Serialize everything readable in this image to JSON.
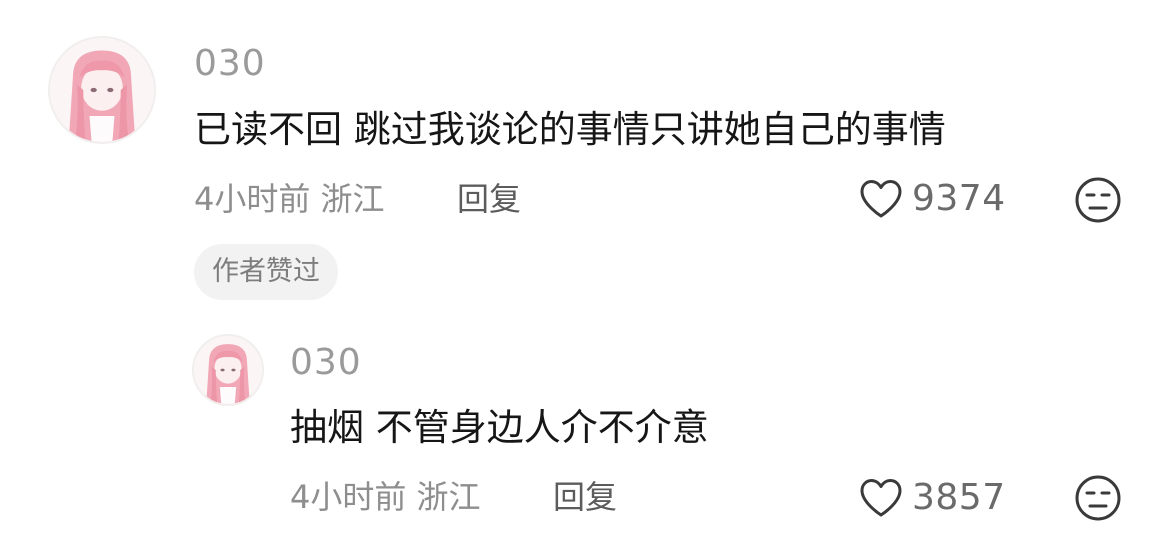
{
  "comments": [
    {
      "username": "030",
      "text": "已读不回 跳过我谈论的事情只讲她自己的事情",
      "meta": "4小时前 浙江",
      "reply_label": "回复",
      "like_count": "9374",
      "badge": "作者赞过",
      "avatar_icon": "anime-girl-avatar"
    },
    {
      "username": "030",
      "text": "抽烟 不管身边人介不介意",
      "meta": "4小时前 浙江",
      "reply_label": "回复",
      "like_count": "3857",
      "avatar_icon": "anime-girl-avatar"
    }
  ],
  "icons": {
    "like": "heart-outline-icon",
    "dislike": "unamused-face-icon"
  },
  "colors": {
    "text_primary": "#161616",
    "text_secondary": "#8e8e8e",
    "badge_bg": "#f2f2f2",
    "avatar_hair": "#f1a3b3"
  }
}
